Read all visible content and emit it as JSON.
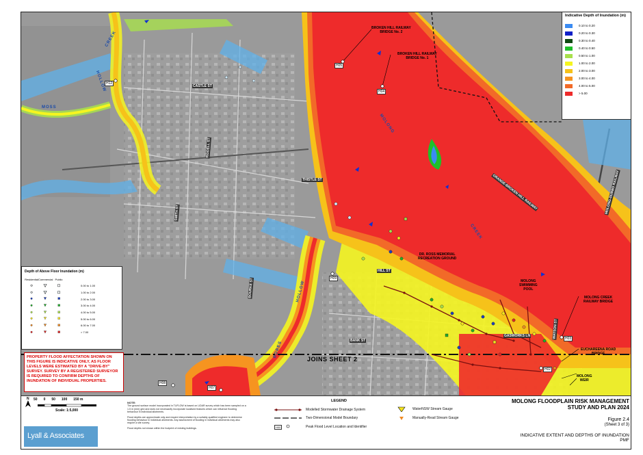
{
  "map": {
    "place_labels": {
      "bridge2": "BROKEN HILL RAILWAY\nBRIDGE No. 2",
      "bridge1": "BROKEN HILL RAILWAY\nBRIDGE No. 1",
      "recreation": "DR. ROSS MEMORIAL\nRECREATION GROUND",
      "pool": "MOLONG\nSWIMMING\nPOOL",
      "creek_bridge": "MOLONG CREEK\nRAILWAY BRIDGE",
      "euch_bridge": "EUCHAREENA ROAD\nBRIDGE",
      "weir": "MOLONG\nWEIR"
    },
    "creek_labels": {
      "creek_nw": "CREEK",
      "moss": "MOSS",
      "molong": "MOLONG",
      "creek_center": "CREEK",
      "hollow_nw": "HOLLOW",
      "hollow_s": "HOLLOW",
      "bores": "BORES"
    },
    "road_labels": {
      "castle": "CASTLE ST",
      "thistle": "THISTLE ST",
      "orange_rail": "ORANGE-BROKEN HILL RAILWAY",
      "dubbo_rail": "MOLONG-DUBBO RAILWAY",
      "gasworks": "GASWORKS LN",
      "watson": "WATSON ST",
      "bank": "BANK ST",
      "riddell": "RIDDELL ST",
      "smith": "SMITH ST",
      "bourke": "BOURKE ST",
      "hill": "HILL ST"
    },
    "gauges": {
      "h05": "H05",
      "h04": "H04",
      "h12": "H12",
      "h09": "H09",
      "h03": "H03",
      "h02": "H02",
      "h08": "H08",
      "h07": "H07"
    },
    "joins_sheet": "JOINS SHEET 2"
  },
  "depth_legend": {
    "title": "Indicative Depth of Inundation (m)",
    "items": [
      {
        "label": "0.10 to 0.20",
        "color": "#3b8bf2"
      },
      {
        "label": "0.20 to 0.30",
        "color": "#1020c8"
      },
      {
        "label": "0.30 to 0.40",
        "color": "#0f4a12"
      },
      {
        "label": "0.40 to 0.50",
        "color": "#1fbf2a"
      },
      {
        "label": "0.50 to 1.00",
        "color": "#a8e04c"
      },
      {
        "label": "1.00 to 2.00",
        "color": "#f5f520"
      },
      {
        "label": "2.00 to 3.00",
        "color": "#f6c21a"
      },
      {
        "label": "3.00 to 4.00",
        "color": "#f69420"
      },
      {
        "label": "4.00 to 5.00",
        "color": "#f26a28"
      },
      {
        "label": "> 5.00",
        "color": "#ee2b2b"
      }
    ]
  },
  "floor_legend": {
    "title": "Depth of Above Floor Inundation (m)",
    "headers": [
      "Residential",
      "Commercial",
      "Public"
    ],
    "items": [
      {
        "label": "0.00 to 1.00",
        "color": "#cfe8f6"
      },
      {
        "label": "1.00 to 2.00",
        "color": "#7fd6e6"
      },
      {
        "label": "2.00 to 3.00",
        "color": "#1c3fbf"
      },
      {
        "label": "3.00 to 4.00",
        "color": "#1fae2a"
      },
      {
        "label": "4.00 to 5.00",
        "color": "#a8e04c"
      },
      {
        "label": "5.00 to 6.00",
        "color": "#f5e41e"
      },
      {
        "label": "6.00 to 7.00",
        "color": "#f08a22"
      },
      {
        "label": "> 7.00",
        "color": "#e02424"
      }
    ]
  },
  "red_note": "PROPERTY FLOOD AFFECTATION SHOWN ON THIS FIGURE IS INDICATIVE ONLY, AS FLOOR LEVELS WERE ESTIMATED BY A \"DRIVE-BY\" SURVEY. SURVEY BY A REGISTERED SURVEYOR IS REQUIRED TO CONFIRM DEPTHS OF INUNDATION OF INDIVIDUAL PROPERTIES.",
  "scale": {
    "ticks": [
      "50",
      "0",
      "50",
      "100",
      "150 m"
    ],
    "label": "Scale: 1:5,000"
  },
  "logo": "Lyall & Associates",
  "notes": {
    "title": "NOTE:",
    "lines": [
      "The ground surface model incorporated in TUFLOW is based on LiDAR survey which has been sampled on a 1.5 m (mm) grid and does not necessarily incorporate localised features which can influence flooding behaviour in individual allotments.",
      "Flood depths are approximate only and require interpretation by a suitably qualified engineer to determine flooding behaviour in individual allotments. Any assessment of flooding in individual allotments may also require a site survey.",
      "Flood depths not shown within the footprint of existing buildings."
    ]
  },
  "legend": {
    "title": "LEGEND",
    "stormwater": "Modelled Stormwater Drainage System",
    "boundary": "Two-Dimensional Model Boundary",
    "peak": "Peak Flood Level Location and Identifier",
    "peak_id": "H00",
    "waternsw": "WaterNSW Stream Gauge",
    "manual": "Manually-Read Stream Gauge"
  },
  "title_block": {
    "title_line1": "MOLONG FLOODPLAIN RISK MANAGEMENT",
    "title_line2": "STUDY AND PLAN 2024",
    "figure": "Figure 2.4",
    "sheet": "(Sheet 3 of 3)",
    "subtitle": "INDICATIVE EXTENT AND DEPTHS OF INUNDATION",
    "event": "PMF"
  }
}
